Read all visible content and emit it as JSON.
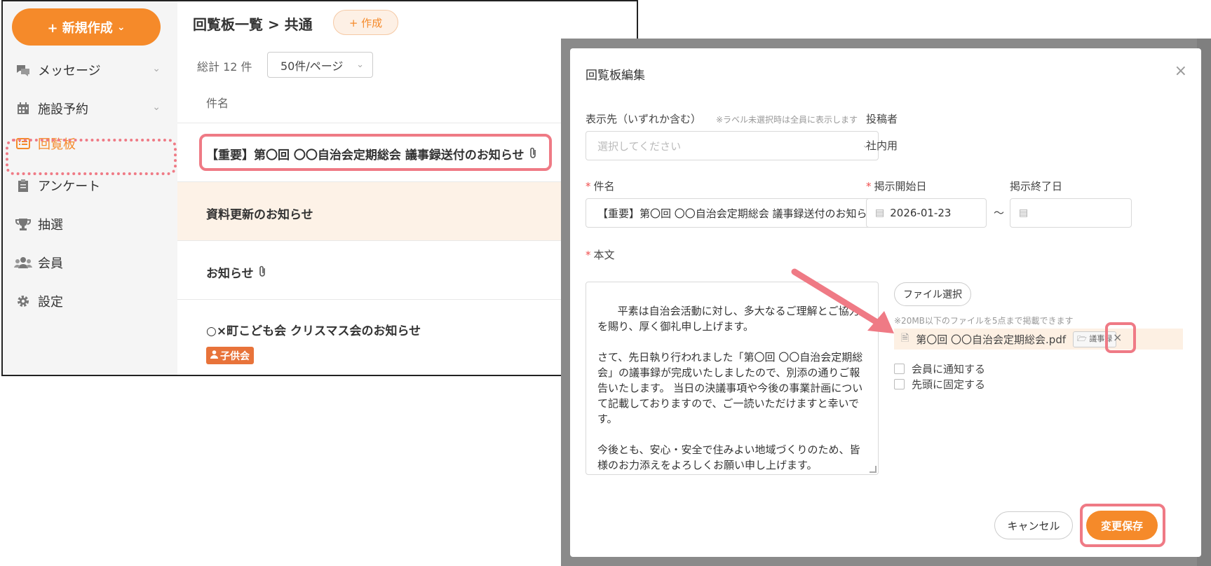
{
  "sidebar": {
    "new_button_label": "+ 新規作成",
    "items": [
      {
        "label": "メッセージ",
        "icon": "chat-icon",
        "has_chevron": true
      },
      {
        "label": "施設予約",
        "icon": "calendar-icon",
        "has_chevron": true
      },
      {
        "label": "回覧板",
        "icon": "list-icon",
        "active": true
      },
      {
        "label": "アンケート",
        "icon": "clipboard-icon"
      },
      {
        "label": "抽選",
        "icon": "trophy-icon"
      },
      {
        "label": "会員",
        "icon": "users-icon"
      },
      {
        "label": "設定",
        "icon": "gear-icon"
      }
    ]
  },
  "list": {
    "breadcrumb": "回覧板一覧 > 共通",
    "create_label": "+ 作成",
    "total": "総計 12 件",
    "per_page": "50件/ページ",
    "column_header": "件名",
    "rows": [
      {
        "title": "【重要】第〇回 〇〇自治会定期総会 議事録送付のお知らせ",
        "attachment": true
      },
      {
        "title": "資料更新のお知らせ",
        "attachment": false
      },
      {
        "title": "お知らせ",
        "attachment": true
      },
      {
        "title": "○×町こども会 クリスマス会のお知らせ",
        "attachment": false,
        "tag": "子供会"
      }
    ]
  },
  "modal": {
    "title": "回覧板編集",
    "display_target_label": "表示先（いずれか含む）",
    "display_target_hint": "※ラベル未選択時は全員に表示します",
    "display_target_placeholder": "選択してください",
    "poster_label": "投稿者",
    "poster_value": "社内用",
    "subject_label": "件名",
    "subject_value": "【重要】第〇回 〇〇自治会定期総会 議事録送付のお知らせ",
    "start_date_label": "掲示開始日",
    "start_date_value": "2026-01-23",
    "end_date_label": "掲示終了日",
    "range_sep": "～",
    "body_label": "本文",
    "body_value": "平素は自治会活動に対し、多大なるご理解とご協力を賜り、厚く御礼申し上げます。\n\nさて、先日執り行われました「第〇回 〇〇自治会定期総会」の議事録が完成いたしましたので、別添の通りご報告いたします。 当日の決議事項や今後の事業計画について記載しておりますので、ご一読いただけますと幸いです。\n\n今後とも、安心・安全で住みよい地域づくりのため、皆様のお力添えをよろしくお願い申し上げます。",
    "file_button": "ファイル選択",
    "file_hint": "※20MB以下のファイルを5点まで掲載できます",
    "file_name": "第〇回 〇〇自治会定期総会.pdf",
    "file_tag": "議事録",
    "notify_label": "会員に通知する",
    "pin_label": "先頭に固定する",
    "cancel_label": "キャンセル",
    "save_label": "変更保存"
  },
  "colors": {
    "accent": "#f58a2a",
    "highlight": "#ef7a85",
    "tag": "#e8733a"
  }
}
